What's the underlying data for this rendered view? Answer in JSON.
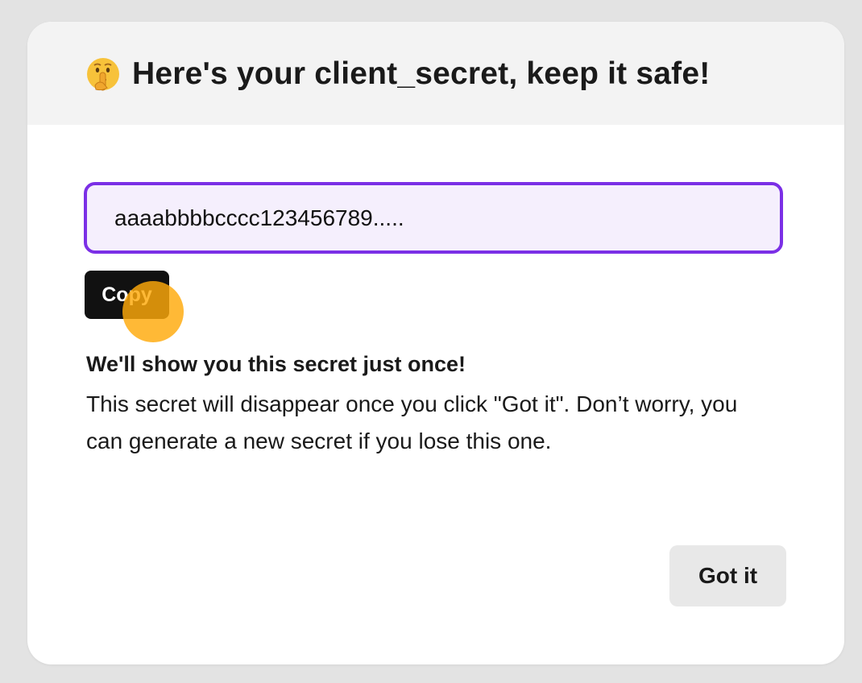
{
  "modal": {
    "title": "Here's your client_secret, keep it safe!",
    "title_icon": "shushing-face-icon"
  },
  "secret": {
    "value": "aaaabbbbcccc123456789....."
  },
  "copy_button": {
    "label": "Copy"
  },
  "warning": {
    "heading": "We'll show you this secret just once!",
    "body": "This secret will disappear once you click \"Got it\". Don’t worry, you can generate a new secret if you lose this one."
  },
  "got_it_button": {
    "label": "Got it"
  },
  "colors": {
    "accent": "#7b2fe6",
    "field_background": "#f5effd",
    "header_background": "#f3f3f3",
    "copy_button_background": "#111111",
    "got_it_button_background": "#e8e8e8",
    "cursor_highlight": "#ffaa0a"
  }
}
